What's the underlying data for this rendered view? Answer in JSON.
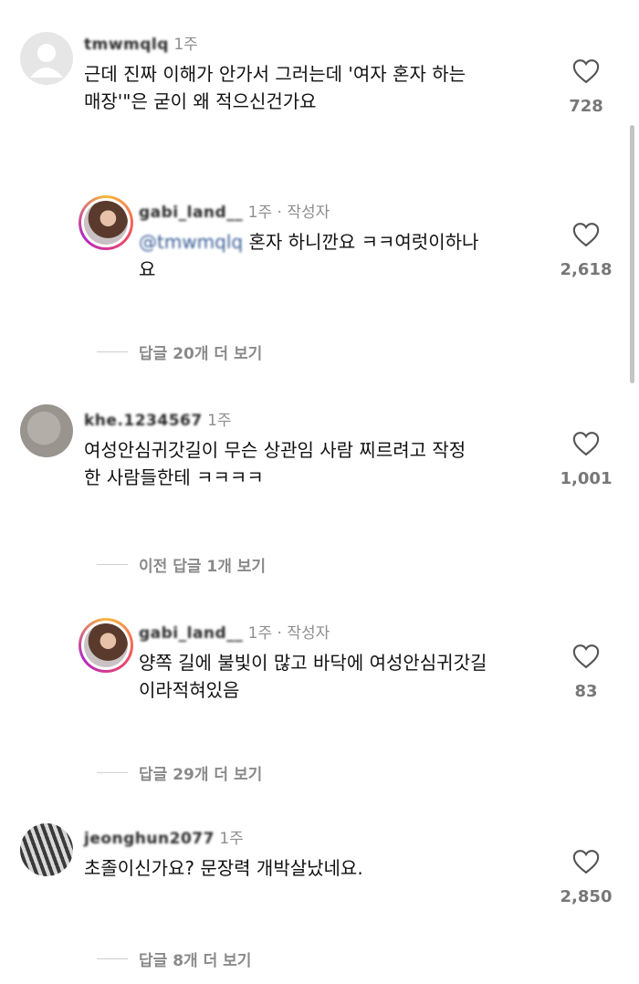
{
  "comments": [
    {
      "username": "tmwmqlq",
      "time": "1주",
      "text_line1": "근데 진짜 이해가 안가서 그러는데 '여자 혼자 하는",
      "text_line2": "매장'\"은 굳이 왜 적으신건가요",
      "likes": "728",
      "avatar": "default-avatar"
    },
    {
      "username": "gabi_land__",
      "time": "1주",
      "author_badge": "작성자",
      "mention": "@tmwmqlq",
      "text_line1": "혼자 하니깐요 ㅋㅋ여럿이하나",
      "text_line2": "요",
      "likes": "2,618",
      "view_replies": "답글 20개 더 보기",
      "avatar": "profile-photo"
    },
    {
      "username": "khe.1234567",
      "time": "1주",
      "text_line1": "여성안심귀갓길이 무슨 상관임 사람 찌르려고 작정",
      "text_line2": "한 사람들한테 ㅋㅋㅋㅋ",
      "likes": "1,001",
      "view_prev_replies": "이전 답글 1개 보기",
      "avatar": "profile-photo"
    },
    {
      "username": "gabi_land__",
      "time": "1주",
      "author_badge": "작성자",
      "text_line1": "양쪽 길에 불빛이 많고 바닥에 여성안심귀갓길",
      "text_line2": "이라적혀있음",
      "likes": "83",
      "view_replies": "답글 29개 더 보기",
      "avatar": "profile-photo"
    },
    {
      "username": "jeonghun2077",
      "time": "1주",
      "text_line1": "초졸이신가요? 문장력 개박살났네요.",
      "likes": "2,850",
      "view_replies": "답글 8개 더 보기",
      "avatar": "profile-photo"
    }
  ],
  "separator": " · ",
  "colors": {
    "text": "#111111",
    "meta": "#8e8e8e",
    "mention": "#3b5f97",
    "story_ring": [
      "#f6b83c",
      "#f04c63",
      "#b427c2"
    ]
  }
}
